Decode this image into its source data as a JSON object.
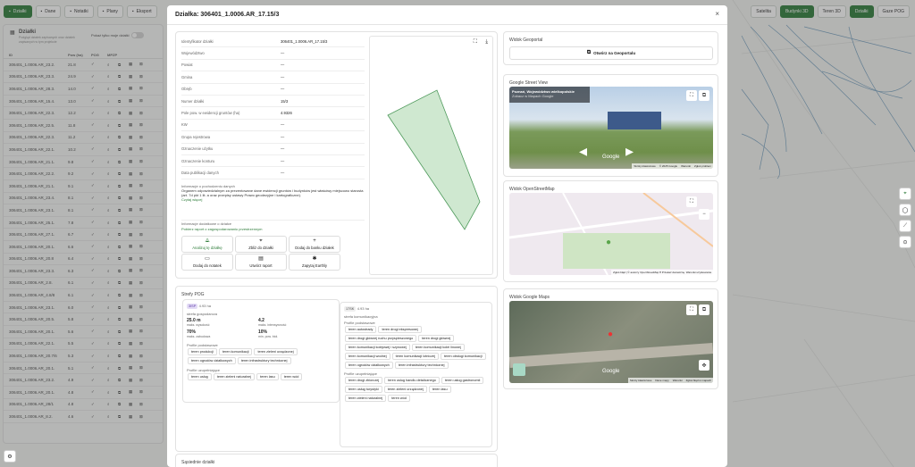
{
  "topbar": {
    "items": [
      {
        "label": "Działki",
        "icon": "grid-icon",
        "active": true
      },
      {
        "label": "Dane",
        "icon": "database-icon",
        "active": false
      },
      {
        "label": "Notatki",
        "icon": "note-icon",
        "active": false
      },
      {
        "label": "Plany",
        "icon": "layers-icon",
        "active": false
      },
      {
        "label": "Eksport",
        "icon": "export-icon",
        "active": false
      }
    ]
  },
  "rightbar": {
    "items": [
      {
        "label": "Satelita",
        "active": false
      },
      {
        "label": "Budynki 3D",
        "active": true
      },
      {
        "label": "Teren 3D",
        "active": false
      },
      {
        "label": "Działki",
        "active": true
      },
      {
        "label": "Gaze POG",
        "active": false
      }
    ]
  },
  "left_panel": {
    "title": "Działki",
    "subtitle": "Podgląd działek zapisanych oraz działek zapisanych w tym projekcie",
    "filter_label": "Pokaż tylko moje działki",
    "headers": [
      "ID",
      "Pow (ha)",
      "POG",
      "MPZP",
      ""
    ],
    "rows": [
      {
        "id": "306401_1.0006.AR_23.2.",
        "area": "21.8"
      },
      {
        "id": "306401_1.0006.AR_23.3.",
        "area": "24.9"
      },
      {
        "id": "306401_1.0006.AR_28.3.",
        "area": "14.0"
      },
      {
        "id": "306401_1.0006.AR_15.4.",
        "area": "13.0"
      },
      {
        "id": "306401_1.0006.AR_22.3.",
        "area": "12.2"
      },
      {
        "id": "306401_1.0006.AR_22.5.",
        "area": "11.8"
      },
      {
        "id": "306401_1.0006.AR_22.3.",
        "area": "11.2"
      },
      {
        "id": "306401_1.0006.AR_22.1.",
        "area": "10.2"
      },
      {
        "id": "306401_1.0006.AR_21.1.",
        "area": "9.8"
      },
      {
        "id": "306401_1.0006.AR_22.2.",
        "area": "9.2"
      },
      {
        "id": "306401_1.0006.AR_21.1.",
        "area": "9.1"
      },
      {
        "id": "306401_1.0006.AR_23.4.",
        "area": "8.1"
      },
      {
        "id": "306401_1.0006.AR_23.1.",
        "area": "8.1"
      },
      {
        "id": "306401_1.0006.AR_25.1.",
        "area": "7.8"
      },
      {
        "id": "306401_1.0006.AR_27.1.",
        "area": "6.7"
      },
      {
        "id": "306401_1.0006.AR_20.1.",
        "area": "6.6"
      },
      {
        "id": "306401_1.0006.AR_20.8",
        "area": "6.4"
      },
      {
        "id": "306401_1.0006.AR_23.3.",
        "area": "6.3"
      },
      {
        "id": "306401_1.0006.AR_2.8.",
        "area": "6.1"
      },
      {
        "id": "306401_1.0006.AR_4.8/8",
        "area": "6.1"
      },
      {
        "id": "306401_1.0006.AR_23.1.",
        "area": "6.0"
      },
      {
        "id": "306401_1.0006.AR_20.5.",
        "area": "5.8"
      },
      {
        "id": "306401_1.0006.AR_20.1.",
        "area": "5.6"
      },
      {
        "id": "306401_1.0006.AR_22.1.",
        "area": "5.5"
      },
      {
        "id": "306401_1.0006.AR_20.7/6",
        "area": "5.3"
      },
      {
        "id": "306401_1.0006.AR_20.1.",
        "area": "5.1"
      },
      {
        "id": "306401_1.0006.AR_23.2.",
        "area": "4.9"
      },
      {
        "id": "306401_1.0006.AR_20.1.",
        "area": "4.8"
      },
      {
        "id": "306401_1.0006.AR_28/1",
        "area": "4.8"
      },
      {
        "id": "306401_1.0006.AR_8.2.",
        "area": "4.6"
      }
    ]
  },
  "modal": {
    "title": "Działka: 306401_1.0006.AR_17.15/3",
    "close": "×",
    "details": [
      {
        "k": "Identyfikator działki",
        "v": "306401_1.0006.AR_17.15/3"
      },
      {
        "k": "Województwo",
        "v": "—"
      },
      {
        "k": "Powiat",
        "v": "—"
      },
      {
        "k": "Gmina",
        "v": "—"
      },
      {
        "k": "Obręb",
        "v": "—"
      },
      {
        "k": "Numer działki",
        "v": "15/3"
      },
      {
        "k": "Pole pow. w ewidencji gruntów (ha)",
        "v": "4.9326"
      },
      {
        "k": "KW",
        "v": "—"
      },
      {
        "k": "Grupa rejestrowa",
        "v": "—"
      },
      {
        "k": "Oznaczenie użytku",
        "v": "—"
      },
      {
        "k": "Oznaczenie konturu",
        "v": "—"
      },
      {
        "k": "Data publikacji danych",
        "v": "—"
      }
    ],
    "source_title": "Informacje o pochodzeniu danych",
    "source_text": "Organem odpowiedzialnym za prezentowane dane ewidencji gruntów i budynków jest właściwy miejscowo starosta (art. 7d pkt 1 lit. a oraz przepisy ustawy Prawo geodezyjne i kartograficzne).",
    "read_more": "Czytaj więcej",
    "extra_title": "Informacje dodatkowe o działce",
    "extra_link": "Pobierz raport o zagospodarowaniu przestrzennym",
    "actions": [
      {
        "label": "Analizuj tę działkę",
        "icon": "analyze-icon",
        "green": true
      },
      {
        "label": "Zbliż do działki",
        "icon": "locate-icon",
        "green": false
      },
      {
        "label": "Dodaj do banku działek",
        "icon": "plus-icon",
        "green": false
      },
      {
        "label": "Dodaj do notatek",
        "icon": "note-icon",
        "green": false
      },
      {
        "label": "Utwórz raport",
        "icon": "report-icon",
        "green": false
      },
      {
        "label": "Zapytaj Earthly",
        "icon": "ask-icon",
        "green": false
      }
    ],
    "pog": {
      "title": "Strefy POG",
      "zones": [
        {
          "code": "3ISP",
          "area": "4.93 ha",
          "type": "strefa gospodarcza",
          "stats": [
            {
              "v": "25.0 m",
              "l": "maks. wysokość"
            },
            {
              "v": "4.2",
              "l": "maks. intensywność"
            },
            {
              "v": "70%",
              "l": "maks. zabudowa"
            },
            {
              "v": "10%",
              "l": "min. pow. biol."
            }
          ],
          "basic_title": "Profile podstawowe",
          "basic": [
            "teren produkcji",
            "teren komunikacji",
            "teren zieleni urządzonej",
            "teren ogrodów działkowych",
            "teren infrastruktury technicznej"
          ],
          "extra_title": "Profile uzupełniające",
          "extra": [
            "teren usług",
            "teren zieleni naturalnej",
            "teren lasu",
            "teren wód"
          ]
        },
        {
          "code": "17SK",
          "area": "4.93 ha",
          "type": "strefa komunikacyjna",
          "basic_title": "Profile podstawowe",
          "basic": [
            "teren autostrady",
            "teren drogi ekspresowej",
            "teren drogi głównej ruchu przyspieszonego",
            "teren drogi głównej",
            "teren komunikacji kolejowej i szynowej",
            "teren komunikacji kolei linowej",
            "teren komunikacji wodnej",
            "teren komunikacji lotniczej",
            "teren obsługi komunikacji",
            "teren ogrodów działkowych",
            "teren infrastruktury technicznej"
          ],
          "extra_title": "Profile uzupełniające",
          "extra": [
            "teren drogi zbiorczej",
            "teren usług handlu detalicznego",
            "teren usług gastronomii",
            "teren usług turystyki",
            "teren zieleni urządzonej",
            "teren lasu",
            "teren zieleni naturalnej",
            "teren wód"
          ]
        }
      ]
    },
    "neighbors_title": "Sąsiednie działki",
    "geoportal": {
      "title": "Widok Geoportal",
      "button": "Otwórz na Geoportalu"
    },
    "streetview": {
      "title": "Google Street View",
      "place": "Poznań, Województwo wielkopolskie",
      "sub": "Zobacz w Mapach Google",
      "footer": [
        "Skróty klawiszowe",
        "© 2025 Google",
        "Warunki",
        "Zgłoś problem"
      ],
      "logo": "Google"
    },
    "osm": {
      "title": "Widok OpenStreetMap",
      "footer": "Zgłoś błąd | © autorzy OpenStreetMap ♥ Przekaż darowiznę. Warunki użytkowania"
    },
    "gmaps": {
      "title": "Widok Google Maps",
      "footer": [
        "Skróty klawiszowe",
        "Dane mapy",
        "Warunki",
        "Zgłoś błąd w mapach"
      ],
      "logo": "Google"
    }
  },
  "colors": {
    "accent": "#2f7d3b",
    "parcel_fill": "#cfe8d0",
    "parcel_stroke": "#4f9a5c"
  }
}
